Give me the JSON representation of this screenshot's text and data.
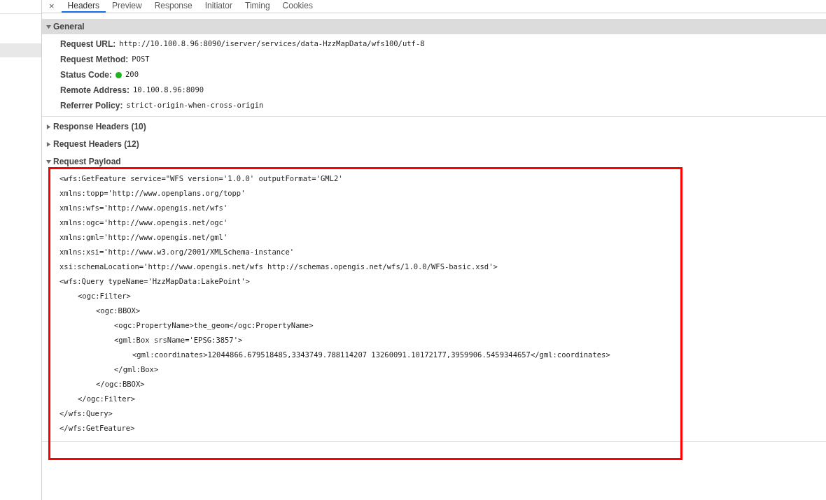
{
  "tabs": [
    {
      "label": "Headers",
      "selected": true
    },
    {
      "label": "Preview",
      "selected": false
    },
    {
      "label": "Response",
      "selected": false
    },
    {
      "label": "Initiator",
      "selected": false
    },
    {
      "label": "Timing",
      "selected": false
    },
    {
      "label": "Cookies",
      "selected": false
    }
  ],
  "close_label": "×",
  "sections": [
    {
      "title": "General",
      "expanded": true,
      "kind": "fields",
      "fields": [
        {
          "label": "Request URL:",
          "value": "http://10.100.8.96:8090/iserver/services/data-HzzMapData/wfs100/utf-8"
        },
        {
          "label": "Request Method:",
          "value": "POST"
        },
        {
          "label": "Status Code:",
          "value": "200",
          "color": "#22b322"
        },
        {
          "label": "Remote Address:",
          "value": "10.100.8.96:8090"
        },
        {
          "label": "Referrer Policy:",
          "value": "strict-origin-when-cross-origin"
        }
      ]
    },
    {
      "title": "Response Headers (10)",
      "expanded": false
    },
    {
      "title": "Request Headers (12)",
      "expanded": false
    },
    {
      "title": "Request Payload",
      "expanded": true,
      "kind": "code",
      "lines": [
        {
          "text": "<wfs:GetFeature service=\"WFS version='1.0.0' outputFormat='GML2'"
        },
        {
          "text": "xmlns:topp='http://www.openplans.org/topp'"
        },
        {
          "text": "xmlns:wfs='http://www.opengis.net/wfs'"
        },
        {
          "text": "xmlns:ogc='http://www.opengis.net/ogc'"
        },
        {
          "text": "xmlns:gml='http://www.opengis.net/gml'"
        },
        {
          "text": "xmlns:xsi='http://www.w3.org/2001/XMLSchema-instance'"
        },
        {
          "text": "xsi:schemaLocation='http://www.opengis.net/wfs http://schemas.opengis.net/wfs/1.0.0/WFS-basic.xsd'>"
        },
        {
          "text": "<wfs:Query typeName='HzzMapData:LakePoint'>",
          "children": [
            {
              "text": "<ogc:Filter>",
              "children": [
                {
                  "text": "<ogc:BBOX>",
                  "children": [
                    {
                      "text": "<ogc:PropertyName>the_geom</ogc:PropertyName>"
                    },
                    {
                      "text": "<gml:Box srsName='EPSG:3857'>",
                      "children": [
                        {
                          "text": "<gml:coordinates>12044866.679518485,3343749.788114207 13260091.10172177,3959906.5459344657</gml:coordinates>"
                        }
                      ]
                    },
                    {
                      "text": "</gml:Box>"
                    }
                  ]
                },
                {
                  "text": "</ogc:BBOX>"
                }
              ]
            },
            {
              "text": "</ogc:Filter>"
            }
          ]
        },
        {
          "text": "</wfs:Query>"
        },
        {
          "text": "</wfs:GetFeature>"
        }
      ]
    }
  ]
}
